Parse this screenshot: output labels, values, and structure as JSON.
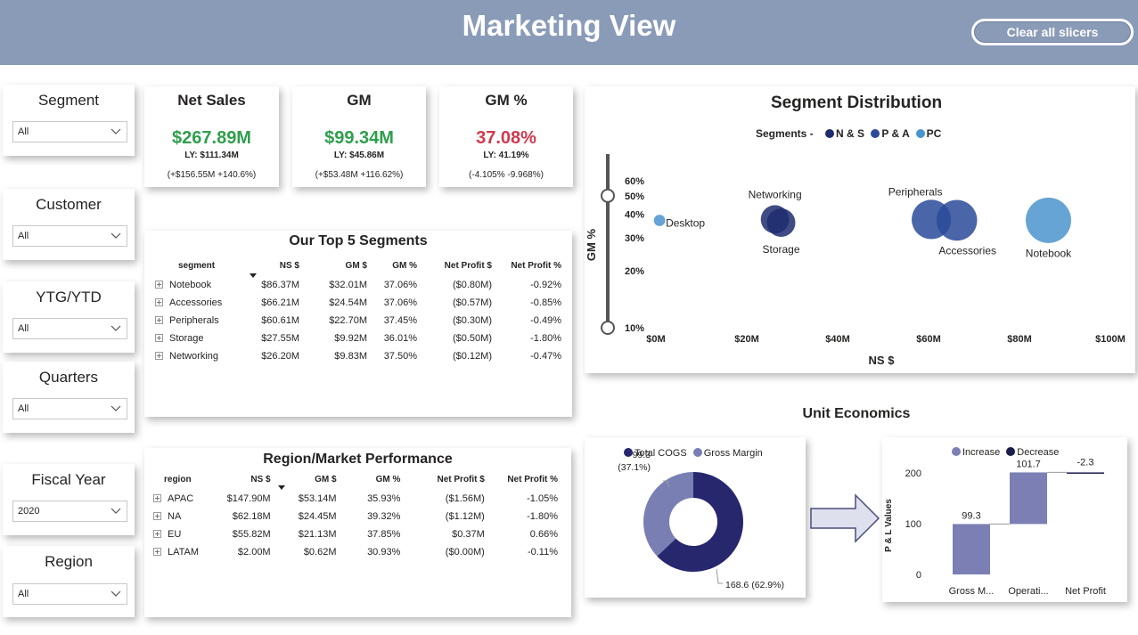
{
  "header": {
    "title": "Marketing View",
    "clear_label": "Clear all slicers"
  },
  "slicers": [
    {
      "title": "Segment",
      "value": "All"
    },
    {
      "title": "Customer",
      "value": "All"
    },
    {
      "title": "YTG/YTD",
      "value": "All"
    },
    {
      "title": "Quarters",
      "value": "All"
    },
    {
      "title": "Fiscal Year",
      "value": "2020"
    },
    {
      "title": "Region",
      "value": "All"
    }
  ],
  "kpis": [
    {
      "title": "Net Sales",
      "value": "$267.89M",
      "ly": "LY: $111.34M",
      "change": "(+$156.55M +140.6%)",
      "tone": "green"
    },
    {
      "title": "GM",
      "value": "$99.34M",
      "ly": "LY: $45.86M",
      "change": "(+$53.48M +116.62%)",
      "tone": "green"
    },
    {
      "title": "GM %",
      "value": "37.08%",
      "ly": "LY: 41.19%",
      "change": "(-4.105% -9.968%)",
      "tone": "red"
    }
  ],
  "top_segments": {
    "title": "Our Top 5 Segments",
    "columns": [
      "segment",
      "NS $",
      "GM $",
      "GM %",
      "Net Profit $",
      "Net Profit %"
    ],
    "rows": [
      [
        "Notebook",
        "$86.37M",
        "$32.01M",
        "37.06%",
        "($0.80M)",
        "-0.92%"
      ],
      [
        "Accessories",
        "$66.21M",
        "$24.54M",
        "37.06%",
        "($0.57M)",
        "-0.85%"
      ],
      [
        "Peripherals",
        "$60.61M",
        "$22.70M",
        "37.45%",
        "($0.30M)",
        "-0.49%"
      ],
      [
        "Storage",
        "$27.55M",
        "$9.92M",
        "36.01%",
        "($0.50M)",
        "-1.80%"
      ],
      [
        "Networking",
        "$26.20M",
        "$9.83M",
        "37.50%",
        "($0.12M)",
        "-0.47%"
      ]
    ]
  },
  "region_performance": {
    "title": "Region/Market Performance",
    "columns": [
      "region",
      "NS $",
      "GM $",
      "GM %",
      "Net Profit $",
      "Net Profit %"
    ],
    "rows": [
      [
        "APAC",
        "$147.90M",
        "$53.14M",
        "35.93%",
        "($1.56M)",
        "-1.05%"
      ],
      [
        "NA",
        "$62.18M",
        "$24.45M",
        "39.32%",
        "($1.12M)",
        "-1.80%"
      ],
      [
        "EU",
        "$55.82M",
        "$21.13M",
        "37.85%",
        "$0.37M",
        "0.66%"
      ],
      [
        "LATAM",
        "$2.00M",
        "$0.62M",
        "30.93%",
        "($0.00M)",
        "-0.11%"
      ]
    ]
  },
  "unit_economics": {
    "title": "Unit Economics"
  },
  "colors": {
    "header": "#8a9bb8",
    "ns": "#1f2d6e",
    "pa": "#2c4a9a",
    "pc": "#4a94cc",
    "cogs": "#27276e",
    "gross_margin": "#7a7fb3",
    "increase": "#7b7fb3",
    "decrease": "#1b1e4a",
    "green": "#2e9f4c",
    "red": "#d0394e"
  },
  "icons": [
    "chevron-down-icon",
    "expand-plus-icon",
    "sort-down-icon",
    "right-arrow-icon",
    "range-slider-handle"
  ],
  "chart_data": [
    {
      "type": "scatter",
      "title": "Segment Distribution",
      "xlabel": "NS $",
      "ylabel": "GM %",
      "legend_title": "Segments -",
      "legend_position": "top",
      "xlim": [
        0,
        100
      ],
      "x_ticks": [
        "$0M",
        "$20M",
        "$40M",
        "$60M",
        "$80M",
        "$100M"
      ],
      "y_ticks": [
        "60%",
        "50%",
        "40%",
        "30%",
        "20%",
        "10%"
      ],
      "y_scale": "log",
      "ylim": [
        10,
        60
      ],
      "series": [
        {
          "name": "N & S",
          "color": "#1f2d6e",
          "points": [
            {
              "label": "Networking",
              "x": 26.2,
              "y": 37.5,
              "size": 9.83
            },
            {
              "label": "Storage",
              "x": 27.55,
              "y": 36.01,
              "size": 9.92
            }
          ]
        },
        {
          "name": "P & A",
          "color": "#2c4a9a",
          "points": [
            {
              "label": "Peripherals",
              "x": 60.61,
              "y": 37.45,
              "size": 22.7
            },
            {
              "label": "Accessories",
              "x": 66.21,
              "y": 37.06,
              "size": 24.54
            }
          ]
        },
        {
          "name": "PC",
          "color": "#4a94cc",
          "points": [
            {
              "label": "Desktop",
              "x": 0.8,
              "y": 37.0,
              "size": 0.4
            },
            {
              "label": "Notebook",
              "x": 86.37,
              "y": 37.06,
              "size": 32.01
            }
          ]
        }
      ]
    },
    {
      "type": "pie",
      "legend_position": "top",
      "slices": [
        {
          "name": "Total COGS",
          "value": 168.6,
          "label": "168.6 (62.9%)",
          "color": "#27276e"
        },
        {
          "name": "Gross Margin",
          "value": 99.3,
          "label": "99.3 (37.1%)",
          "color": "#7a7fb3"
        }
      ]
    },
    {
      "type": "bar",
      "subtype": "waterfall",
      "ylabel": "P & L Values",
      "legend": [
        "Increase",
        "Decrease"
      ],
      "legend_position": "top",
      "categories": [
        "Gross M...",
        "Operati...",
        "Net Profit"
      ],
      "values": [
        99.3,
        101.7,
        -2.3
      ],
      "value_labels": [
        "99.3",
        "101.7",
        "-2.3"
      ],
      "y_ticks": [
        "200",
        "100",
        "0"
      ],
      "ylim": [
        0,
        200
      ]
    }
  ]
}
